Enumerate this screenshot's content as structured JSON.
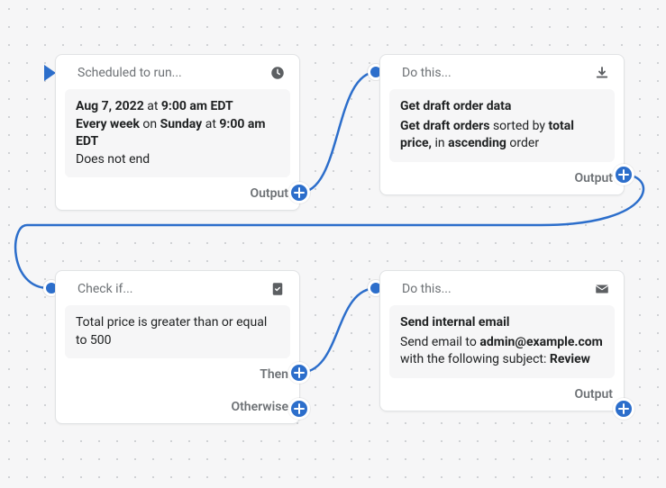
{
  "nodes": {
    "schedule": {
      "header": "Scheduled to run...",
      "date_prefix": "Aug 7, 2022",
      "at1": " at ",
      "time1": "9:00 am EDT",
      "line2_a": "Every week",
      "line2_b": " on ",
      "line2_c": "Sunday",
      "line2_d": " at ",
      "line2_e": "9:00 am EDT",
      "line3": "Does not end",
      "output": "Output"
    },
    "action1": {
      "header": "Do this...",
      "title": "Get draft order data",
      "desc_a": "Get draft orders",
      "desc_b": " sorted by ",
      "desc_c": "total price,",
      "desc_d": " in ",
      "desc_e": "ascending",
      "desc_f": " order",
      "output": "Output"
    },
    "condition": {
      "header": "Check if...",
      "body": "Total price is greater than or equal to 500",
      "then": "Then",
      "otherwise": "Otherwise"
    },
    "action2": {
      "header": "Do this...",
      "title": "Send internal email",
      "desc_a": "Send email to ",
      "desc_b": "admin@example.com",
      "desc_c": " with the following subject: ",
      "desc_d": "Review",
      "output": "Output"
    }
  }
}
